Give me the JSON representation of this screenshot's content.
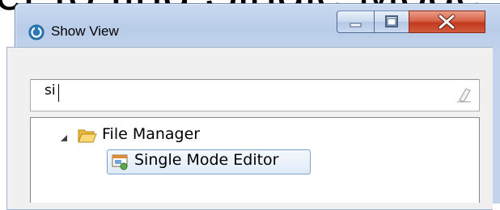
{
  "caption": "er to find Single Mode",
  "window": {
    "title": "Show View",
    "buttons": {
      "minimize": "minimize",
      "maximize": "maximize",
      "close": "close"
    }
  },
  "filter": {
    "value": "si"
  },
  "tree": {
    "folder": {
      "label": "File Manager",
      "expanded": true
    },
    "items": [
      {
        "label": "Single Mode Editor",
        "selected": true
      }
    ]
  },
  "colors": {
    "selection": "#dfeaf8",
    "close_button": "#c33a1f",
    "folder": "#f2c45c"
  }
}
